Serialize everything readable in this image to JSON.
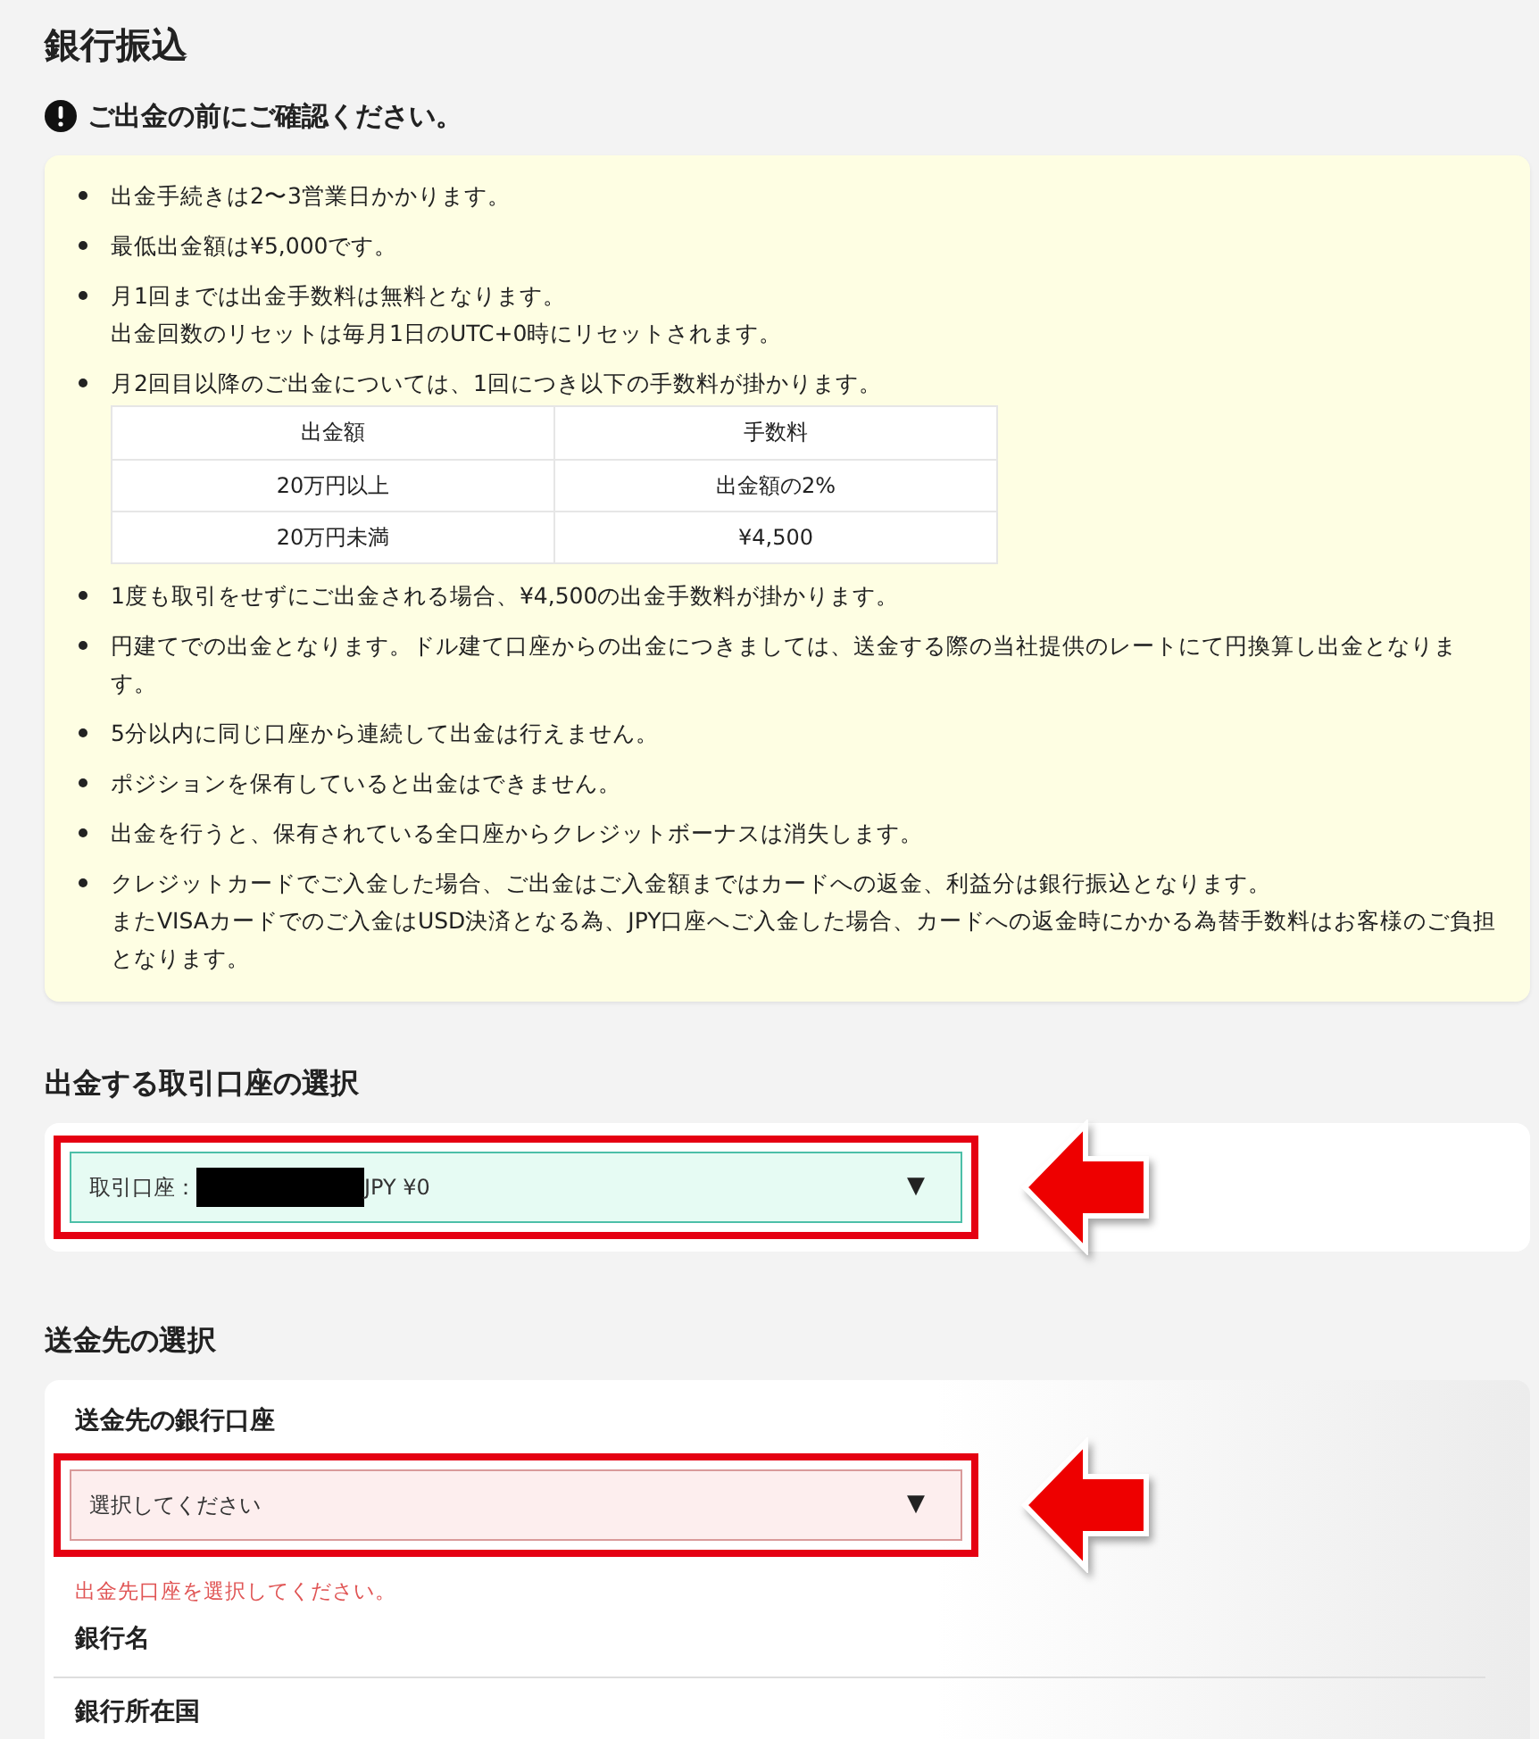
{
  "title": "銀行振込",
  "notice": {
    "heading": "ご出金の前にご確認ください。",
    "items": [
      {
        "lines": [
          "出金手続きは2〜3営業日かかります。"
        ]
      },
      {
        "lines": [
          "最低出金額は¥5,000です。"
        ]
      },
      {
        "lines": [
          "月1回までは出金手数料は無料となります。",
          "出金回数のリセットは毎月1日のUTC+0時にリセットされます。"
        ]
      },
      {
        "lines": [
          "月2回目以降のご出金については、1回につき以下の手数料が掛かります。"
        ],
        "table": {
          "columns": [
            "出金額",
            "手数料"
          ],
          "rows": [
            [
              "20万円以上",
              "出金額の2%"
            ],
            [
              "20万円未満",
              "¥4,500"
            ]
          ]
        }
      },
      {
        "lines": [
          "1度も取引をせずにご出金される場合、¥4,500の出金手数料が掛かります。"
        ]
      },
      {
        "lines": [
          "円建てでの出金となります。ドル建て口座からの出金につきましては、送金する際の当社提供のレートにて円換算し出金となります。"
        ]
      },
      {
        "lines": [
          "5分以内に同じ口座から連続して出金は行えません。"
        ]
      },
      {
        "lines": [
          "ポジションを保有していると出金はできません。"
        ]
      },
      {
        "lines": [
          "出金を行うと、保有されている全口座からクレジットボーナスは消失します。"
        ]
      },
      {
        "lines": [
          "クレジットカードでご入金した場合、ご出金はご入金額まではカードへの返金、利益分は銀行振込となります。",
          "またVISAカードでのご入金はUSD決済となる為、JPY口座へご入金した場合、カードへの返金時にかかる為替手数料はお客様のご負担となります。"
        ]
      }
    ]
  },
  "account_section": {
    "heading": "出金する取引口座の選択",
    "select": {
      "prefix": "取引口座：",
      "redacted": true,
      "value": "JPY ¥0",
      "caret": "▼",
      "invalid": false,
      "highlighted": true
    }
  },
  "destination_section": {
    "heading": "送金先の選択",
    "field_label": "送金先の銀行口座",
    "select": {
      "value": "選択してください",
      "caret": "▼",
      "invalid": true,
      "highlighted": true
    },
    "error": "出金先口座を選択してください。",
    "fields": [
      "銀行名",
      "銀行所在国"
    ]
  }
}
